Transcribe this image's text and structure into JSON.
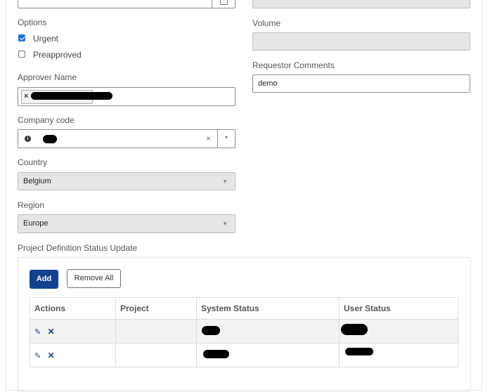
{
  "form": {
    "options": {
      "label": "Options",
      "urgent": {
        "label": "Urgent",
        "checked": true
      },
      "preapproved": {
        "label": "Preapproved",
        "checked": false
      }
    },
    "volume": {
      "label": "Volume",
      "value": ""
    },
    "approver": {
      "label": "Approver Name",
      "tag_remove_glyph": "×"
    },
    "requestor_comments": {
      "label": "Requestor Comments",
      "value": "demo"
    },
    "company_code": {
      "label": "Company code",
      "info_glyph": "i",
      "clear_glyph": "×",
      "dropdown_glyph": "▼"
    },
    "country": {
      "label": "Country",
      "value": "Belgium",
      "dropdown_glyph": "▼"
    },
    "region": {
      "label": "Region",
      "value": "Europe",
      "dropdown_glyph": "▼"
    }
  },
  "project_section": {
    "title": "Project Definition Status Update",
    "add_label": "Add",
    "remove_all_label": "Remove All",
    "columns": [
      "Actions",
      "Project",
      "System Status",
      "User Status"
    ],
    "rows": [
      {
        "project": ""
      },
      {
        "project": ""
      }
    ],
    "edit_glyph": "✎",
    "delete_glyph": "✕"
  },
  "colors": {
    "accent": "#124191",
    "checkbox_checked": "#1a73e8"
  }
}
